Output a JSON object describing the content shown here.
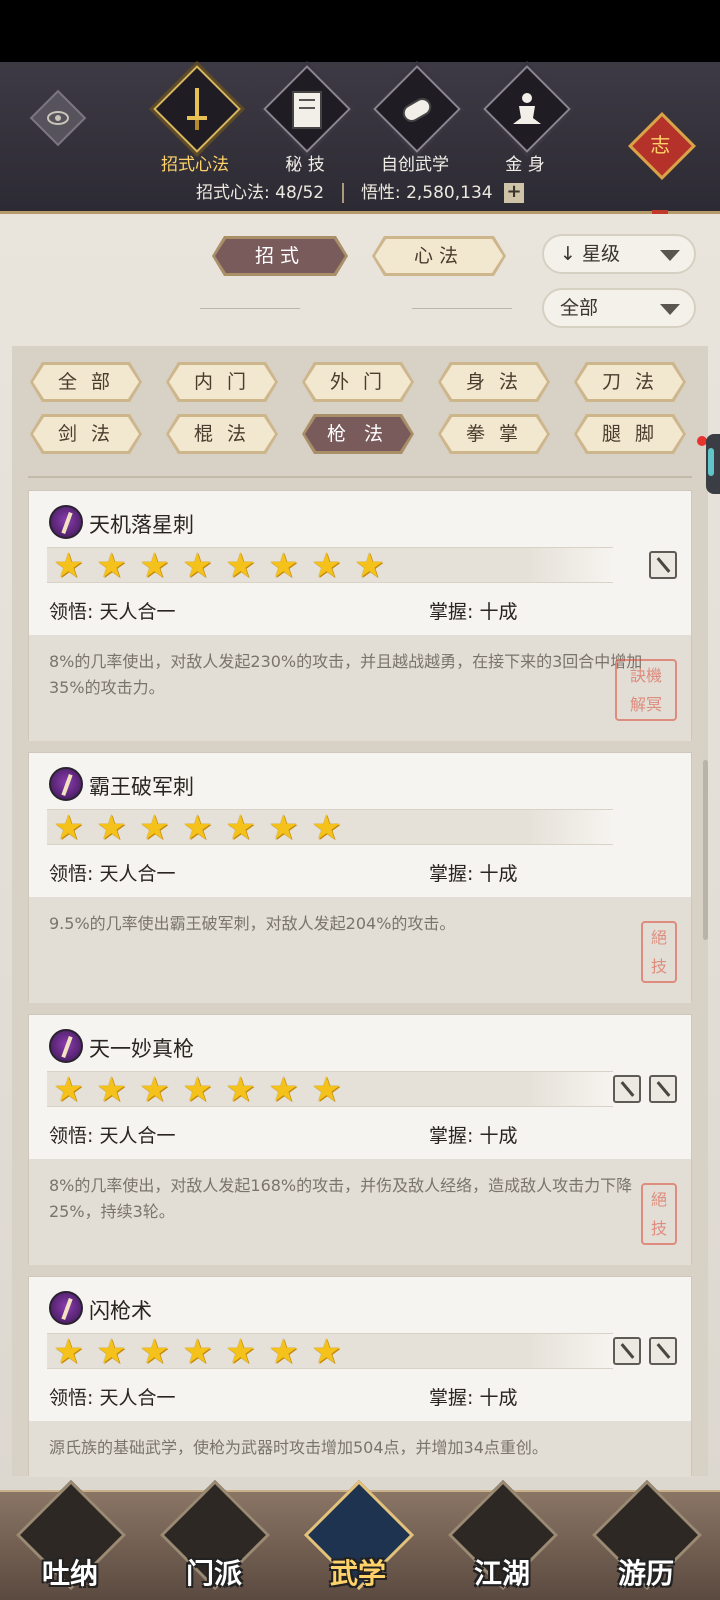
{
  "header": {
    "tabs": [
      {
        "label": "招式心法",
        "icon": "sword-icon",
        "active": true
      },
      {
        "label": "秘 技",
        "icon": "book-icon",
        "active": false
      },
      {
        "label": "自创武学",
        "icon": "scroll-icon",
        "active": false
      },
      {
        "label": "金 身",
        "icon": "meditation-icon",
        "active": false
      }
    ],
    "badge": "志",
    "stats_left": "招式心法: 48/52",
    "stats_right": "悟性: 2,580,134",
    "plus": "+"
  },
  "filters": {
    "mode_tabs": [
      {
        "label": "招式",
        "active": true
      },
      {
        "label": "心法",
        "active": false
      }
    ],
    "sort": "星级",
    "sort_arrow": "↓",
    "range": "全部"
  },
  "categories": [
    {
      "label": "全 部",
      "active": false
    },
    {
      "label": "内 门",
      "active": false
    },
    {
      "label": "外 门",
      "active": false
    },
    {
      "label": "身 法",
      "active": false
    },
    {
      "label": "刀 法",
      "active": false
    },
    {
      "label": "剑 法",
      "active": false
    },
    {
      "label": "棍 法",
      "active": false
    },
    {
      "label": "枪 法",
      "active": true
    },
    {
      "label": "拳 掌",
      "active": false
    },
    {
      "label": "腿 脚",
      "active": false
    }
  ],
  "skills": [
    {
      "name": "天机落星刺",
      "stars": 8,
      "comprehension": "领悟: 天人合一",
      "mastery": "掌握: 十成",
      "description": "8%的几率使出，对敌人发起230%的攻击，并且越战越勇，在接下来的3回合中增加35%的攻击力。",
      "seal": "訣機解冥",
      "weapon_icons": 1
    },
    {
      "name": "霸王破军刺",
      "stars": 7,
      "comprehension": "领悟: 天人合一",
      "mastery": "掌握: 十成",
      "description": "9.5%的几率使出霸王破军刺，对敌人发起204%的攻击。",
      "seal": "絕技",
      "weapon_icons": 0
    },
    {
      "name": "天一妙真枪",
      "stars": 7,
      "comprehension": "领悟: 天人合一",
      "mastery": "掌握: 十成",
      "description": "8%的几率使出，对敌人发起168%的攻击，并伤及敌人经络，造成敌人攻击力下降25%，持续3轮。",
      "seal": "絕技",
      "weapon_icons": 2
    },
    {
      "name": "闪枪术",
      "stars": 7,
      "comprehension": "领悟: 天人合一",
      "mastery": "掌握: 十成",
      "description": "源氏族的基础武学，使枪为武器时攻击增加504点，并增加34点重创。",
      "seal": "",
      "weapon_icons": 2
    }
  ],
  "bottom_nav": [
    {
      "label": "吐纳",
      "active": false
    },
    {
      "label": "门派",
      "active": false
    },
    {
      "label": "武学",
      "active": true
    },
    {
      "label": "江湖",
      "active": false
    },
    {
      "label": "游历",
      "active": false
    }
  ]
}
